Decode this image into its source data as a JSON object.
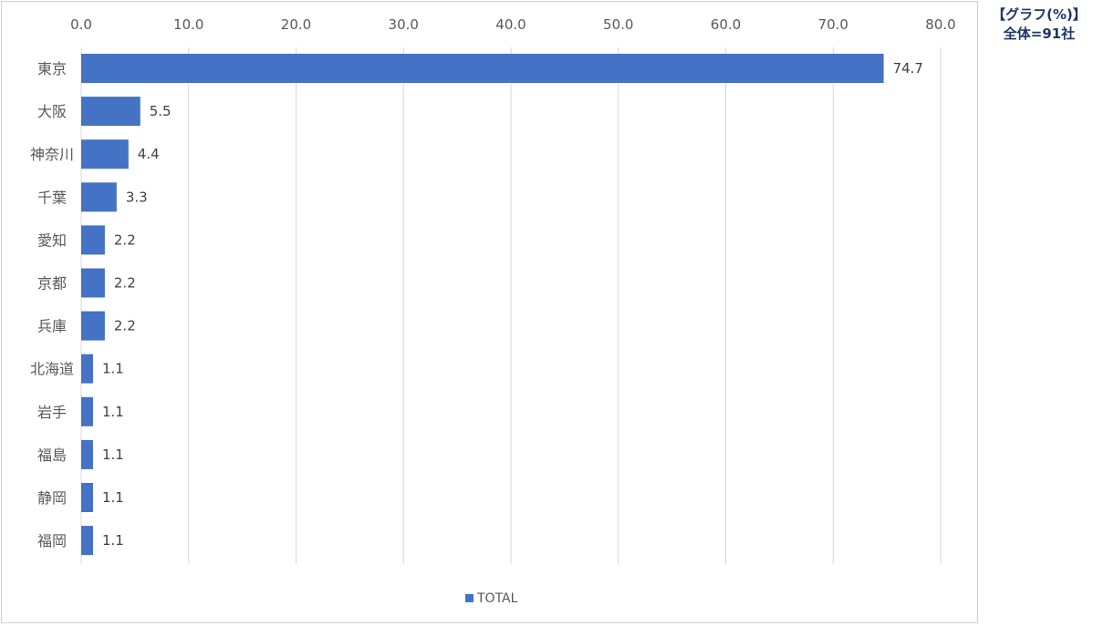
{
  "note": {
    "line1": "【グラフ(%)】",
    "line2": "全体=91社"
  },
  "chart_data": {
    "type": "bar",
    "orientation": "horizontal",
    "categories": [
      "東京",
      "大阪",
      "神奈川",
      "千葉",
      "愛知",
      "京都",
      "兵庫",
      "北海道",
      "岩手",
      "福島",
      "静岡",
      "福岡"
    ],
    "series": [
      {
        "name": "TOTAL",
        "values": [
          74.7,
          5.5,
          4.4,
          3.3,
          2.2,
          2.2,
          2.2,
          1.1,
          1.1,
          1.1,
          1.1,
          1.1
        ],
        "labels": [
          "74.7",
          "5.5",
          "4.4",
          "3.3",
          "2.2",
          "2.2",
          "2.2",
          "1.1",
          "1.1",
          "1.1",
          "1.1",
          "1.1"
        ],
        "color": "#4472c4"
      }
    ],
    "xlim": [
      0,
      80
    ],
    "ticks": [
      "0.0",
      "10.0",
      "20.0",
      "30.0",
      "40.0",
      "50.0",
      "60.0",
      "70.0",
      "80.0"
    ],
    "tick_values": [
      0,
      10,
      20,
      30,
      40,
      50,
      60,
      70,
      80
    ],
    "axis_position": "top",
    "grid": true,
    "grid_color": "#d9d9d9",
    "legend_position": "bottom"
  }
}
